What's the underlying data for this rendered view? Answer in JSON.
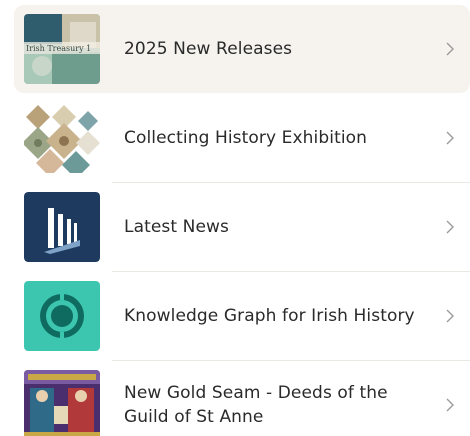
{
  "menu": {
    "items": [
      {
        "label": "2025 New Releases",
        "thumb_text": "Irish Treasury 1"
      },
      {
        "label": "Collecting History Exhibition"
      },
      {
        "label": "Latest News"
      },
      {
        "label": "Knowledge Graph for Irish History"
      },
      {
        "label": "New Gold Seam - Deeds of the Guild of St Anne"
      }
    ]
  },
  "colors": {
    "active_bg": "#f6f3ee",
    "text": "#2a2a2a",
    "chevron": "#9a9a9a",
    "news_blue": "#1e3a5f",
    "graph_teal": "#3cc6b0"
  },
  "icons": [
    "chevron-right-icon",
    "news-logo-icon",
    "knowledge-graph-icon"
  ]
}
